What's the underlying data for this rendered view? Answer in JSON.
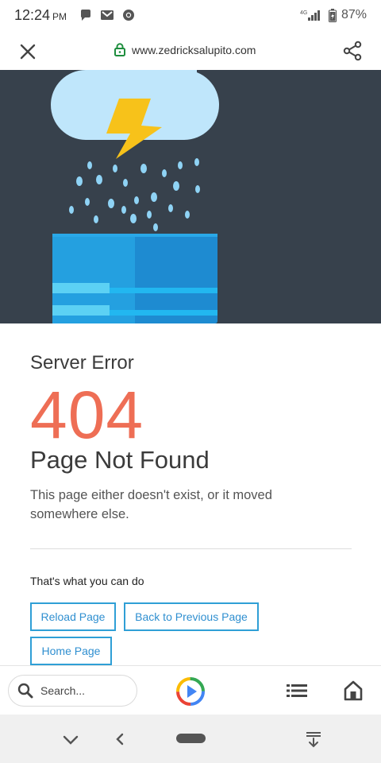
{
  "status_bar": {
    "time": "12:24",
    "ampm": "PM",
    "network": "4G",
    "battery": "87%"
  },
  "browser": {
    "url": "www.zedricksalupito.com",
    "icons": [
      "close-icon",
      "lock-icon",
      "share-icon"
    ]
  },
  "page": {
    "server_error": "Server Error",
    "code": "404",
    "title": "Page Not Found",
    "description": "This page either doesn't exist, or it moved somewhere else.",
    "subheading": "That's what you can do",
    "buttons": {
      "reload": "Reload Page",
      "back": "Back to Previous Page",
      "home": "Home Page"
    }
  },
  "toolbar": {
    "search_placeholder": "Search...",
    "icons": [
      "search-icon",
      "play-icon",
      "list-icon",
      "home-icon"
    ]
  },
  "nav_bar": {
    "icons": [
      "chevron-down-icon",
      "back-icon",
      "home-pill",
      "keyboard-hide-icon"
    ]
  },
  "colors": {
    "error_code": "#ee6e55",
    "hero_background": "#37414c",
    "button_border": "#2f9fd6",
    "secure_lock": "#1e8e3e"
  }
}
